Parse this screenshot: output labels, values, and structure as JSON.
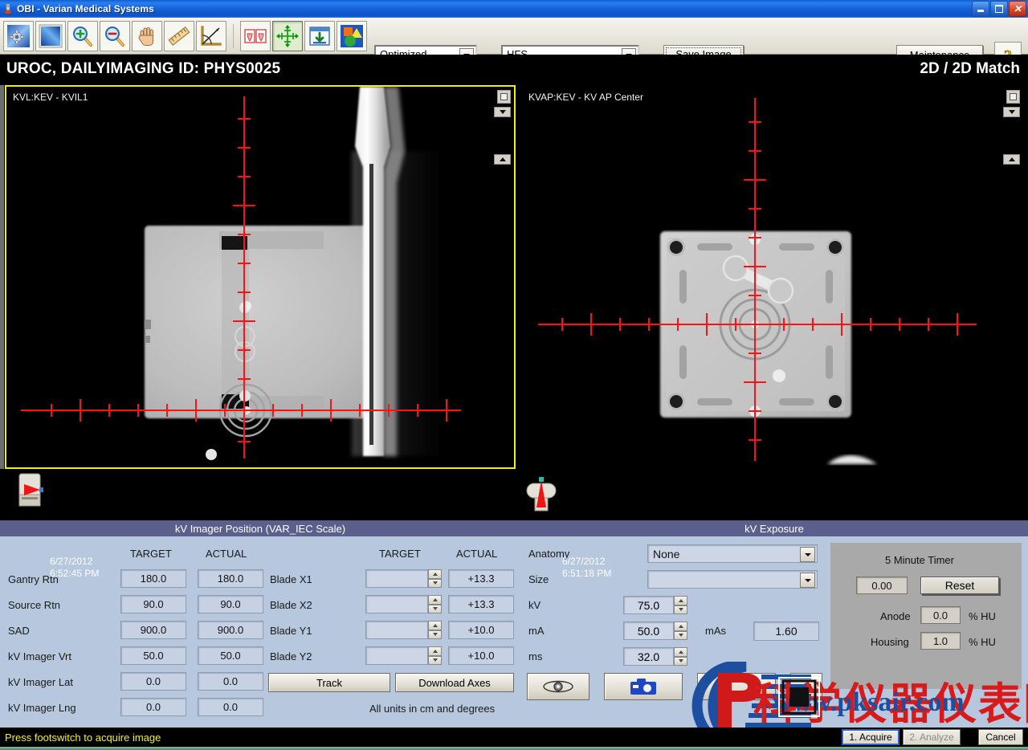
{
  "window": {
    "title": "OBI - Varian Medical Systems",
    "app_icon": "varian-obi-icon",
    "minimize": "–",
    "restore": "❐",
    "close": "✕"
  },
  "toolbar": {
    "buttons": [
      {
        "name": "settings-icon",
        "tip": "Settings"
      },
      {
        "name": "window-level-icon",
        "tip": "Window/Level"
      },
      {
        "name": "zoom-in-icon",
        "tip": "Zoom In"
      },
      {
        "name": "zoom-out-icon",
        "tip": "Zoom Out"
      },
      {
        "name": "pan-hand-icon",
        "tip": "Pan"
      },
      {
        "name": "ruler-icon",
        "tip": "Measure Distance"
      },
      {
        "name": "angle-icon",
        "tip": "Measure Angle"
      },
      {
        "name": "compare-images-icon",
        "tip": "Side by Side"
      },
      {
        "name": "crosshair-move-icon",
        "tip": "Move Crosshair"
      },
      {
        "name": "import-image-icon",
        "tip": "Import"
      },
      {
        "name": "overlay-shapes-icon",
        "tip": "Overlays"
      }
    ],
    "mode_select": {
      "value": "Optimized"
    },
    "orientation_select": {
      "value": "HFS"
    },
    "save_image_label": "Save Image",
    "maintenance_label": "Maintenance",
    "help_label": "?"
  },
  "patient": {
    "name_id": "UROC, DAILYIMAGING   ID: PHYS0025",
    "match_mode": "2D / 2D Match"
  },
  "viewports": [
    {
      "label": "KVL:KEV - KVIL1",
      "date": "6/27/2012",
      "time": "6:52:45 PM",
      "selected": true,
      "beam_icon": "lateral-beam-icon",
      "patient_icon": "patient-lateral-icon"
    },
    {
      "label": "KVAP:KEV - KV AP Center",
      "date": "6/27/2012",
      "time": "6:51:18 PM",
      "selected": false,
      "beam_icon": "ap-beam-icon",
      "patient_icon": "patient-ap-icon"
    }
  ],
  "imager_position": {
    "title": "kV Imager Position (VAR_IEC Scale)",
    "col_target": "TARGET",
    "col_actual": "ACTUAL",
    "axes": [
      {
        "label": "Gantry Rtn",
        "target": "180.0",
        "actual": "180.0"
      },
      {
        "label": "Source Rtn",
        "target": "90.0",
        "actual": "90.0"
      },
      {
        "label": "SAD",
        "target": "900.0",
        "actual": "900.0"
      },
      {
        "label": "kV Imager Vrt",
        "target": "50.0",
        "actual": "50.0"
      },
      {
        "label": "kV Imager Lat",
        "target": "0.0",
        "actual": "0.0"
      },
      {
        "label": "kV Imager Lng",
        "target": "0.0",
        "actual": "0.0"
      }
    ],
    "blades": [
      {
        "label": "Blade X1",
        "target": "",
        "actual": "+13.3"
      },
      {
        "label": "Blade X2",
        "target": "",
        "actual": "+13.3"
      },
      {
        "label": "Blade Y1",
        "target": "",
        "actual": "+10.0"
      },
      {
        "label": "Blade Y2",
        "target": "",
        "actual": "+10.0"
      }
    ],
    "track_label": "Track",
    "download_axes_label": "Download Axes",
    "units_note": "All units in cm and degrees"
  },
  "exposure": {
    "title": "kV Exposure",
    "anatomy_label": "Anatomy",
    "anatomy_value": "None",
    "size_label": "Size",
    "size_value": "",
    "kv_label": "kV",
    "kv_value": "75.0",
    "ma_label": "mA",
    "ma_value": "50.0",
    "mas_label": "mAs",
    "mas_value": "1.60",
    "ms_label": "ms",
    "ms_value": "32.0",
    "fluoro_button_icon": "fluoro-eye-icon",
    "acquire_button_icon": "camera-icon"
  },
  "timer": {
    "title": "5 Minute Timer",
    "value": "0.00",
    "reset_label": "Reset",
    "anode_label": "Anode",
    "anode_value": "0.0",
    "anode_unit": "% HU",
    "housing_label": "Housing",
    "housing_value": "1.0",
    "housing_unit": "% HU"
  },
  "statusbar": {
    "message": "Press footswitch to acquire image",
    "acquire_label": "1. Acquire",
    "analyze_label": "2. Analyze",
    "cancel_label": "Cancel"
  },
  "watermark": {
    "cn_text": "科学仪器仪表网",
    "url_text": "www.pksair.com",
    "logo_text": "P"
  },
  "colors": {
    "selected_border": "#f2ed19",
    "panel_header": "#5a5f8c",
    "panel_body": "#b6c7de",
    "status_text": "#f2ef32",
    "graticule": "#ff1111"
  }
}
